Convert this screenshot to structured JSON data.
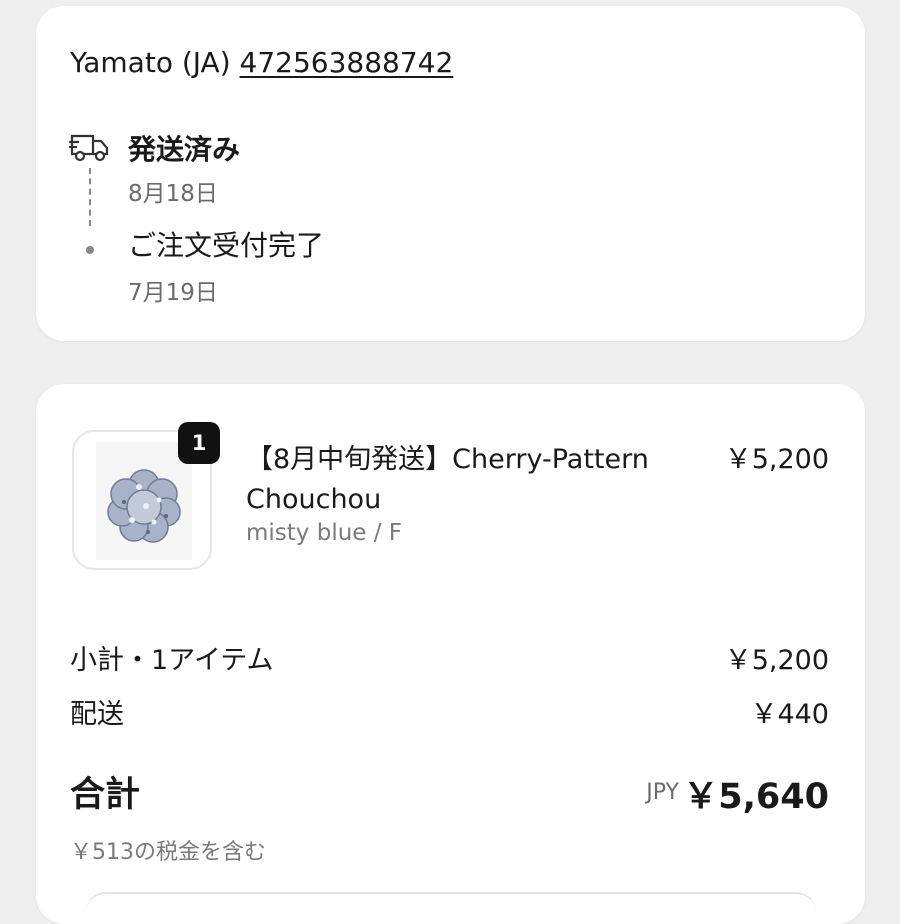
{
  "shipping": {
    "carrier": "Yamato (JA)",
    "tracking_number": "472563888742",
    "events": [
      {
        "title": "発送済み",
        "date": "8月18日"
      },
      {
        "title": "ご注文受付完了",
        "date": "7月19日"
      }
    ]
  },
  "order": {
    "item": {
      "quantity": "1",
      "name": "【8月中旬発送】Cherry-Pattern Chouchou",
      "variant": "misty blue / F",
      "price": "￥5,200"
    },
    "subtotal_label": "小計・1アイテム",
    "subtotal_value": "￥5,200",
    "shipping_label": "配送",
    "shipping_value": "￥440",
    "total_label": "合計",
    "total_currency": "JPY",
    "total_value": "￥5,640",
    "tax_note": "￥513の税金を含む"
  },
  "colors": {
    "background": "#efefef",
    "card": "#ffffff",
    "muted_text": "#6b6b6b",
    "badge": "#111111",
    "product_tone": "#9aa7bd"
  }
}
